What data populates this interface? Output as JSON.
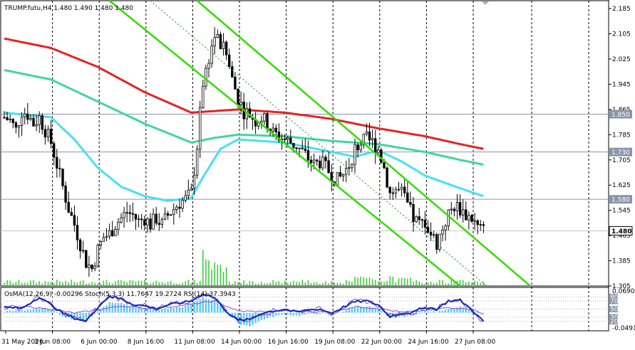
{
  "header": {
    "main_info": "TRUMP.futu,H4  1.480 1.490 1.480 1.480",
    "sub_info": "OsMA(12,26,9) -0.00296  Stoch(5,3,3) 11.7647 19.2724  RSI(14) 37.3943"
  },
  "colors": {
    "candle": "#000000",
    "ma_red": "#e32323",
    "ma_green": "#3fd6a0",
    "ma_cyan": "#48e0f0",
    "channel": "#33dd00",
    "osma": "#5cc7f2",
    "stoch_main": "#0a2ab8",
    "stoch_signal": "#8844cc",
    "rsi": "#7a55c8",
    "hline": "#8a96a8",
    "grid": "#000000"
  },
  "chart_data": {
    "type": "candlestick",
    "symbol": "TRUMP.futu",
    "timeframe": "H4",
    "ylim": [
      1.305,
      2.21
    ],
    "y_ticks": [
      "2.185",
      "2.105",
      "2.025",
      "1.945",
      "1.865",
      "1.785",
      "1.705",
      "1.625",
      "1.545",
      "1.465",
      "1.385",
      "1.305"
    ],
    "y_tick_values": [
      2.185,
      2.105,
      2.025,
      1.945,
      1.865,
      1.785,
      1.705,
      1.625,
      1.545,
      1.465,
      1.385,
      1.305
    ],
    "x_ticks": [
      "31 May 2026",
      "3 Jun 08:00",
      "6 Jun 00:00",
      "8 Jun 16:00",
      "11 Jun 08:00",
      "14 Jun 00:00",
      "16 Jun 16:00",
      "19 Jun 08:00",
      "22 Jun 00:00",
      "24 Jun 16:00",
      "27 Jun 08:00"
    ],
    "x_tick_index": [
      0,
      16,
      32,
      48,
      64,
      80,
      96,
      112,
      128,
      144,
      160
    ],
    "price_levels": [
      {
        "value": 1.85,
        "label": "1.850"
      },
      {
        "value": 1.73,
        "label": "1.730"
      },
      {
        "value": 1.58,
        "label": "1.580"
      }
    ],
    "current_price": {
      "value": 1.48,
      "label": "1.480"
    },
    "close_anchors": [
      [
        0,
        1.84
      ],
      [
        2,
        1.83
      ],
      [
        4,
        1.8
      ],
      [
        6,
        1.86
      ],
      [
        8,
        1.85
      ],
      [
        10,
        1.82
      ],
      [
        12,
        1.84
      ],
      [
        14,
        1.8
      ],
      [
        16,
        1.76
      ],
      [
        18,
        1.69
      ],
      [
        20,
        1.62
      ],
      [
        22,
        1.55
      ],
      [
        24,
        1.5
      ],
      [
        26,
        1.44
      ],
      [
        28,
        1.38
      ],
      [
        30,
        1.36
      ],
      [
        32,
        1.42
      ],
      [
        34,
        1.46
      ],
      [
        36,
        1.47
      ],
      [
        38,
        1.5
      ],
      [
        40,
        1.52
      ],
      [
        42,
        1.54
      ],
      [
        44,
        1.53
      ],
      [
        46,
        1.51
      ],
      [
        48,
        1.52
      ],
      [
        50,
        1.5
      ],
      [
        52,
        1.52
      ],
      [
        54,
        1.5
      ],
      [
        56,
        1.53
      ],
      [
        58,
        1.55
      ],
      [
        60,
        1.57
      ],
      [
        62,
        1.58
      ],
      [
        64,
        1.6
      ],
      [
        66,
        1.75
      ],
      [
        68,
        1.95
      ],
      [
        70,
        2.03
      ],
      [
        72,
        2.1
      ],
      [
        74,
        2.07
      ],
      [
        76,
        2.04
      ],
      [
        78,
        1.96
      ],
      [
        80,
        1.9
      ],
      [
        82,
        1.86
      ],
      [
        84,
        1.85
      ],
      [
        86,
        1.83
      ],
      [
        88,
        1.84
      ],
      [
        90,
        1.82
      ],
      [
        92,
        1.79
      ],
      [
        94,
        1.78
      ],
      [
        96,
        1.77
      ],
      [
        98,
        1.76
      ],
      [
        100,
        1.75
      ],
      [
        102,
        1.73
      ],
      [
        104,
        1.71
      ],
      [
        106,
        1.69
      ],
      [
        108,
        1.7
      ],
      [
        110,
        1.68
      ],
      [
        112,
        1.66
      ],
      [
        114,
        1.64
      ],
      [
        116,
        1.66
      ],
      [
        118,
        1.69
      ],
      [
        120,
        1.74
      ],
      [
        122,
        1.76
      ],
      [
        124,
        1.77
      ],
      [
        126,
        1.76
      ],
      [
        128,
        1.74
      ],
      [
        130,
        1.68
      ],
      [
        132,
        1.6
      ],
      [
        134,
        1.61
      ],
      [
        136,
        1.6
      ],
      [
        138,
        1.56
      ],
      [
        140,
        1.52
      ],
      [
        142,
        1.5
      ],
      [
        144,
        1.51
      ],
      [
        146,
        1.47
      ],
      [
        148,
        1.44
      ],
      [
        150,
        1.49
      ],
      [
        152,
        1.53
      ],
      [
        154,
        1.56
      ],
      [
        156,
        1.55
      ],
      [
        158,
        1.53
      ],
      [
        160,
        1.52
      ],
      [
        162,
        1.49
      ],
      [
        164,
        1.48
      ]
    ],
    "series": [
      {
        "kind": "ma",
        "color": "ma_red",
        "points": [
          [
            0,
            2.09
          ],
          [
            16,
            2.06
          ],
          [
            32,
            2.0
          ],
          [
            48,
            1.92
          ],
          [
            64,
            1.855
          ],
          [
            80,
            1.865
          ],
          [
            96,
            1.855
          ],
          [
            112,
            1.835
          ],
          [
            128,
            1.805
          ],
          [
            144,
            1.78
          ],
          [
            156,
            1.755
          ],
          [
            164,
            1.74
          ]
        ]
      },
      {
        "kind": "ma",
        "color": "ma_green",
        "points": [
          [
            0,
            1.99
          ],
          [
            16,
            1.96
          ],
          [
            32,
            1.89
          ],
          [
            48,
            1.82
          ],
          [
            64,
            1.76
          ],
          [
            72,
            1.775
          ],
          [
            80,
            1.785
          ],
          [
            96,
            1.78
          ],
          [
            112,
            1.765
          ],
          [
            128,
            1.755
          ],
          [
            144,
            1.73
          ],
          [
            156,
            1.705
          ],
          [
            164,
            1.69
          ]
        ]
      },
      {
        "kind": "ma",
        "color": "ma_cyan",
        "points": [
          [
            0,
            1.855
          ],
          [
            16,
            1.84
          ],
          [
            24,
            1.77
          ],
          [
            32,
            1.68
          ],
          [
            40,
            1.62
          ],
          [
            48,
            1.59
          ],
          [
            56,
            1.575
          ],
          [
            64,
            1.585
          ],
          [
            68,
            1.65
          ],
          [
            74,
            1.74
          ],
          [
            80,
            1.77
          ],
          [
            96,
            1.76
          ],
          [
            112,
            1.73
          ],
          [
            120,
            1.715
          ],
          [
            128,
            1.735
          ],
          [
            136,
            1.7
          ],
          [
            144,
            1.655
          ],
          [
            156,
            1.615
          ],
          [
            164,
            1.59
          ]
        ]
      }
    ],
    "channel_lines": [
      {
        "style": "solid",
        "points": [
          [
            36,
            2.21
          ],
          [
            156,
            1.305
          ]
        ]
      },
      {
        "style": "solid",
        "points": [
          [
            66,
            2.21
          ],
          [
            180,
            1.305
          ]
        ]
      },
      {
        "style": "dashed",
        "points": [
          [
            50,
            2.21
          ],
          [
            165,
            1.305
          ]
        ]
      }
    ],
    "osma_ylim": [
      -0.04918,
      0.06906
    ],
    "osma_ticks": [
      "0.06906",
      "-0.04918"
    ],
    "osma_tick_values": [
      0.06906,
      -0.04918
    ],
    "osc_levels": [
      "80",
      "70",
      "50",
      "30",
      "20"
    ],
    "osc_level_values": [
      80,
      70,
      50,
      30,
      20
    ],
    "osma_anchors": [
      [
        0,
        0.004
      ],
      [
        6,
        0.006
      ],
      [
        12,
        0.012
      ],
      [
        16,
        0.008
      ],
      [
        20,
        -0.008
      ],
      [
        24,
        -0.018
      ],
      [
        28,
        -0.022
      ],
      [
        32,
        0.004
      ],
      [
        36,
        0.028
      ],
      [
        40,
        0.026
      ],
      [
        44,
        0.016
      ],
      [
        48,
        0.012
      ],
      [
        52,
        0.008
      ],
      [
        56,
        0.012
      ],
      [
        60,
        0.014
      ],
      [
        64,
        0.024
      ],
      [
        68,
        0.04
      ],
      [
        72,
        0.034
      ],
      [
        76,
        0.01
      ],
      [
        80,
        -0.03
      ],
      [
        84,
        -0.036
      ],
      [
        88,
        -0.02
      ],
      [
        92,
        -0.01
      ],
      [
        96,
        -0.004
      ],
      [
        100,
        -0.008
      ],
      [
        104,
        -0.004
      ],
      [
        108,
        -0.002
      ],
      [
        112,
        -0.006
      ],
      [
        116,
        0.004
      ],
      [
        120,
        0.016
      ],
      [
        124,
        0.018
      ],
      [
        128,
        0.01
      ],
      [
        132,
        -0.014
      ],
      [
        136,
        -0.01
      ],
      [
        140,
        -0.006
      ],
      [
        144,
        0.004
      ],
      [
        148,
        0.002
      ],
      [
        152,
        0.012
      ],
      [
        156,
        0.016
      ],
      [
        160,
        0.006
      ],
      [
        164,
        -0.003
      ]
    ],
    "stoch_anchors": [
      [
        0,
        55
      ],
      [
        6,
        52
      ],
      [
        12,
        80
      ],
      [
        16,
        60
      ],
      [
        20,
        40
      ],
      [
        24,
        28
      ],
      [
        28,
        20
      ],
      [
        32,
        55
      ],
      [
        36,
        82
      ],
      [
        40,
        75
      ],
      [
        44,
        62
      ],
      [
        48,
        58
      ],
      [
        52,
        50
      ],
      [
        56,
        60
      ],
      [
        60,
        65
      ],
      [
        64,
        70
      ],
      [
        68,
        88
      ],
      [
        72,
        78
      ],
      [
        76,
        45
      ],
      [
        80,
        22
      ],
      [
        84,
        24
      ],
      [
        88,
        40
      ],
      [
        92,
        45
      ],
      [
        96,
        50
      ],
      [
        100,
        42
      ],
      [
        104,
        48
      ],
      [
        108,
        50
      ],
      [
        112,
        40
      ],
      [
        116,
        55
      ],
      [
        120,
        68
      ],
      [
        124,
        70
      ],
      [
        128,
        60
      ],
      [
        132,
        32
      ],
      [
        136,
        40
      ],
      [
        140,
        42
      ],
      [
        144,
        55
      ],
      [
        148,
        50
      ],
      [
        152,
        70
      ],
      [
        156,
        72
      ],
      [
        160,
        48
      ],
      [
        164,
        19
      ]
    ],
    "rsi_anchors": [
      [
        0,
        52
      ],
      [
        8,
        56
      ],
      [
        16,
        50
      ],
      [
        24,
        40
      ],
      [
        32,
        48
      ],
      [
        40,
        58
      ],
      [
        48,
        52
      ],
      [
        56,
        55
      ],
      [
        64,
        62
      ],
      [
        72,
        70
      ],
      [
        80,
        45
      ],
      [
        88,
        44
      ],
      [
        96,
        46
      ],
      [
        104,
        44
      ],
      [
        112,
        43
      ],
      [
        120,
        56
      ],
      [
        128,
        52
      ],
      [
        136,
        42
      ],
      [
        144,
        46
      ],
      [
        152,
        54
      ],
      [
        160,
        50
      ],
      [
        164,
        37
      ]
    ]
  }
}
